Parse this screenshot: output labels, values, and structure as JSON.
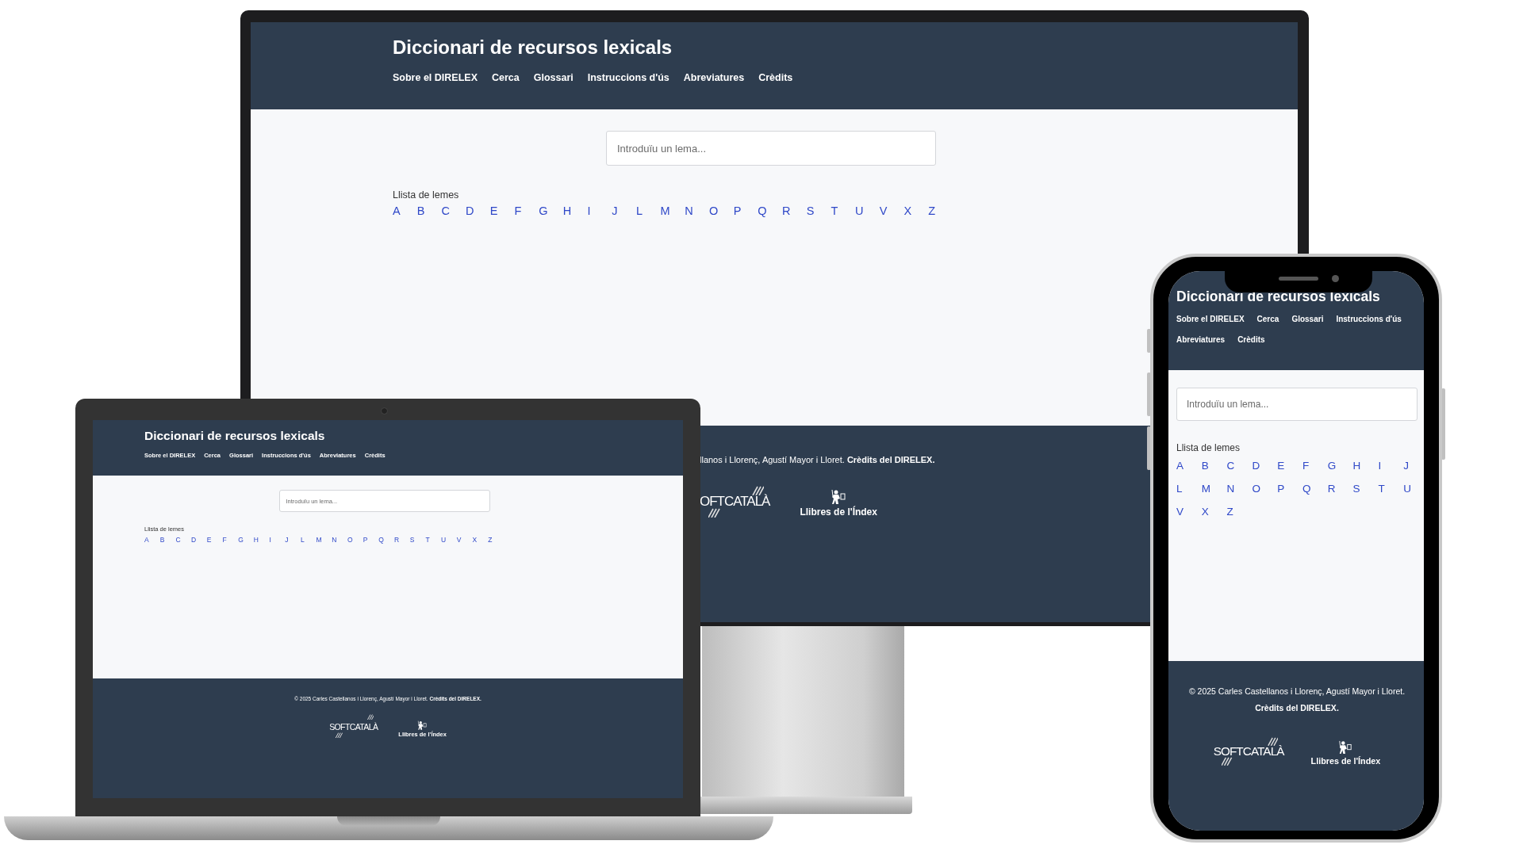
{
  "devices": [
    {
      "kind": "monitor",
      "site": {
        "title": "Diccionari de recursos lexicals",
        "nav": [
          "Sobre el DIRELEX",
          "Cerca",
          "Glossari",
          "Instruccions d'ús",
          "Abreviatures",
          "Crèdits"
        ],
        "search": {
          "placeholder": "Introduïu un lema..."
        },
        "list_label": "Llista de lemes",
        "letters": [
          "A",
          "B",
          "C",
          "D",
          "E",
          "F",
          "G",
          "H",
          "I",
          "J",
          "L",
          "M",
          "N",
          "O",
          "P",
          "Q",
          "R",
          "S",
          "T",
          "U",
          "V",
          "X",
          "Z"
        ],
        "footer": {
          "copyright": "llanos i Llorenç, Agustí Mayor i Lloret.",
          "credits": "Crèdits del DIRELEX.",
          "logos": [
            {
              "kind": "softcatala",
              "text": "OFTCATALÀ"
            },
            {
              "kind": "index",
              "text": "Llibres de l'Índex"
            }
          ]
        }
      }
    },
    {
      "kind": "laptop",
      "site": {
        "title": "Diccionari de recursos lexicals",
        "nav": [
          "Sobre el DIRELEX",
          "Cerca",
          "Glossari",
          "Instruccions d'ús",
          "Abreviatures",
          "Crèdits"
        ],
        "search": {
          "placeholder": "Introduïu un lema..."
        },
        "list_label": "Llista de lemes",
        "letters": [
          "A",
          "B",
          "C",
          "D",
          "E",
          "F",
          "G",
          "H",
          "I",
          "J",
          "L",
          "M",
          "N",
          "O",
          "P",
          "Q",
          "R",
          "S",
          "T",
          "U",
          "V",
          "X",
          "Z"
        ],
        "footer": {
          "copyright": "© 2025 Carles Castellanos i Llorenç, Agustí Mayor i Lloret.",
          "credits": "Crèdits del DIRELEX.",
          "logos": [
            {
              "kind": "softcatala",
              "text": "SOFTCATALÀ"
            },
            {
              "kind": "index",
              "text": "Llibres de l'Índex"
            }
          ]
        }
      }
    },
    {
      "kind": "phone",
      "site": {
        "title": "Diccionari de recursos lexicals",
        "nav": [
          "Sobre el DIRELEX",
          "Cerca",
          "Glossari",
          "Instruccions d'ús",
          "Abreviatures",
          "Crèdits"
        ],
        "search": {
          "placeholder": "Introduïu un lema..."
        },
        "list_label": "Llista de lemes",
        "letters": [
          "A",
          "B",
          "C",
          "D",
          "E",
          "F",
          "G",
          "H",
          "I",
          "J",
          "L",
          "M",
          "N",
          "O",
          "P",
          "Q",
          "R",
          "S",
          "T",
          "U",
          "V",
          "X",
          "Z"
        ],
        "footer": {
          "copyright": "© 2025 Carles Castellanos i Llorenç, Agustí Mayor i Lloret.",
          "credits": "Crèdits del DIRELEX.",
          "logos": [
            {
              "kind": "softcatala",
              "text": "SOFTCATALÀ"
            },
            {
              "kind": "index",
              "text": "Llibres de l'Índex"
            }
          ]
        }
      }
    }
  ]
}
